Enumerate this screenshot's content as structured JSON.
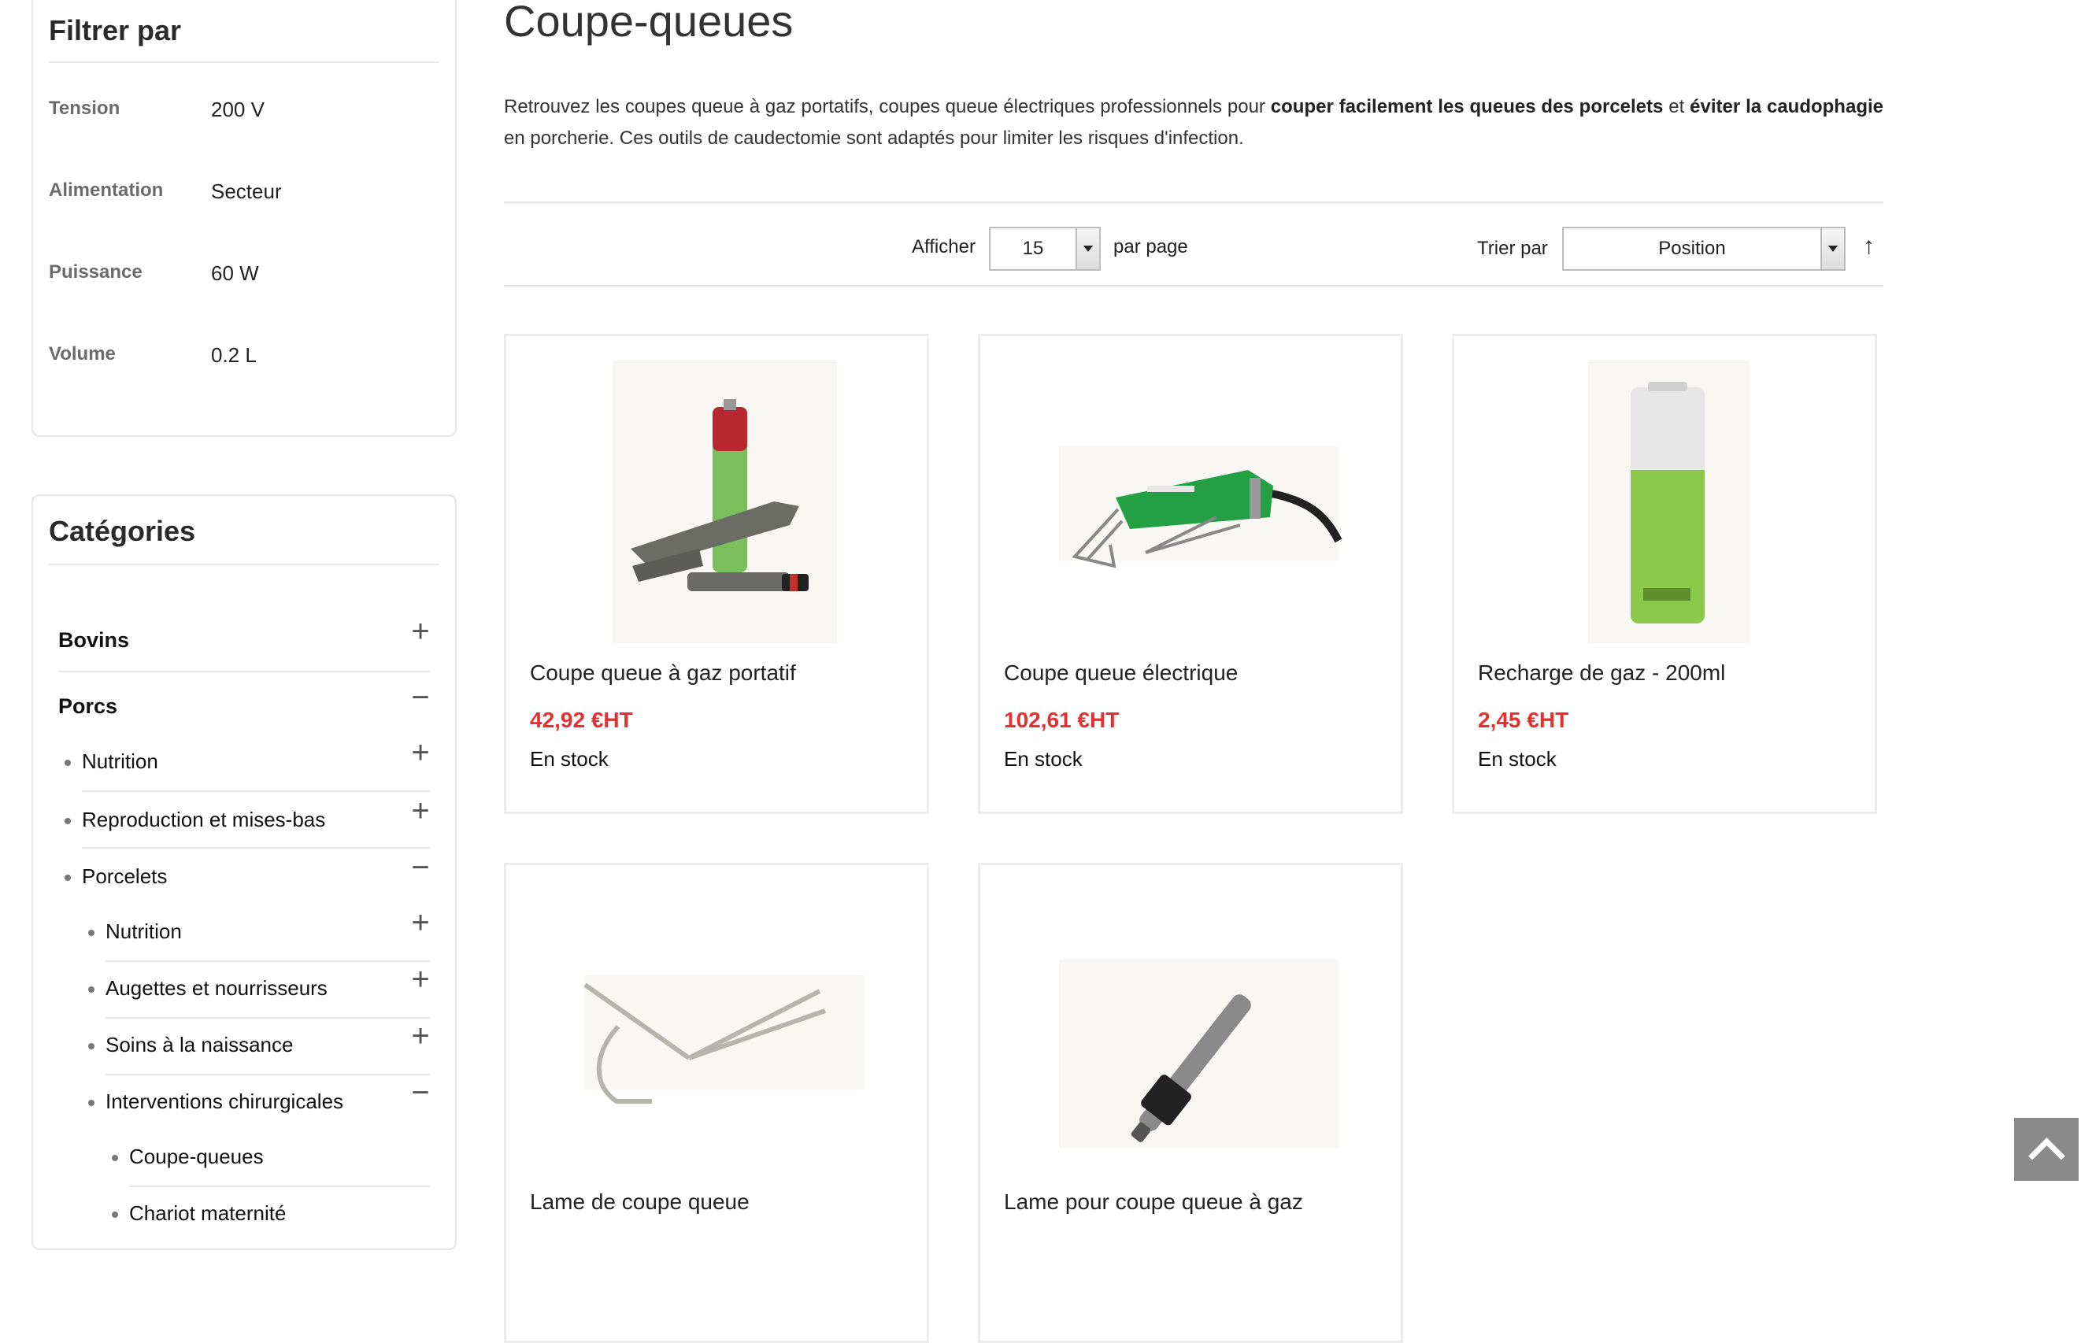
{
  "filters": {
    "title": "Filtrer par",
    "rows": [
      {
        "label": "Tension",
        "value": "200 V"
      },
      {
        "label": "Alimentation",
        "value": "Secteur"
      },
      {
        "label": "Puissance",
        "value": "60 W"
      },
      {
        "label": "Volume",
        "value": "0.2 L"
      }
    ]
  },
  "categories": {
    "title": "Catégories",
    "items": [
      {
        "label": "Bovins",
        "toggle": "+"
      },
      {
        "label": "Porcs",
        "toggle": "−"
      },
      {
        "label": "Nutrition",
        "toggle": "+"
      },
      {
        "label": "Reproduction et mises-bas",
        "toggle": "+"
      },
      {
        "label": "Porcelets",
        "toggle": "−"
      },
      {
        "label": "Nutrition",
        "toggle": "+"
      },
      {
        "label": "Augettes et nourrisseurs",
        "toggle": "+"
      },
      {
        "label": "Soins à la naissance",
        "toggle": "+"
      },
      {
        "label": "Interventions chirurgicales",
        "toggle": "−"
      },
      {
        "label": "Coupe-queues"
      },
      {
        "label": "Chariot maternité"
      }
    ]
  },
  "page": {
    "title": "Coupe-queues",
    "description": {
      "p1": "Retrouvez les coupes queue à gaz portatifs, coupes queue électriques professionnels pour ",
      "b1": "couper facilement les queues des porcelets",
      "p2": " et ",
      "b2": "éviter la caudophagie",
      "p3": " en porcherie. Ces outils de caudectomie sont adaptés pour limiter les risques d'infection."
    }
  },
  "toolbar": {
    "show_label": "Afficher",
    "per_page_value": "15",
    "per_page_suffix": "par page",
    "sort_label": "Trier par",
    "sort_value": "Position",
    "sort_direction": "↑"
  },
  "products": [
    {
      "name": "Coupe queue à gaz portatif",
      "price": "42,92 €HT",
      "stock": "En stock"
    },
    {
      "name": "Coupe queue électrique",
      "price": "102,61 €HT",
      "stock": "En stock"
    },
    {
      "name": "Recharge de gaz - 200ml",
      "price": "2,45 €HT",
      "stock": "En stock"
    },
    {
      "name": "Lame de coupe queue",
      "price": "",
      "stock": ""
    },
    {
      "name": "Lame pour coupe queue à gaz",
      "price": "",
      "stock": ""
    }
  ],
  "icons": {
    "scroll_top": "chevron-up-icon",
    "expand": "plus-icon",
    "collapse": "minus-icon"
  },
  "colors": {
    "price": "#e53030",
    "border": "#e6e6e6",
    "scroll_button": "#8a8a8a"
  }
}
